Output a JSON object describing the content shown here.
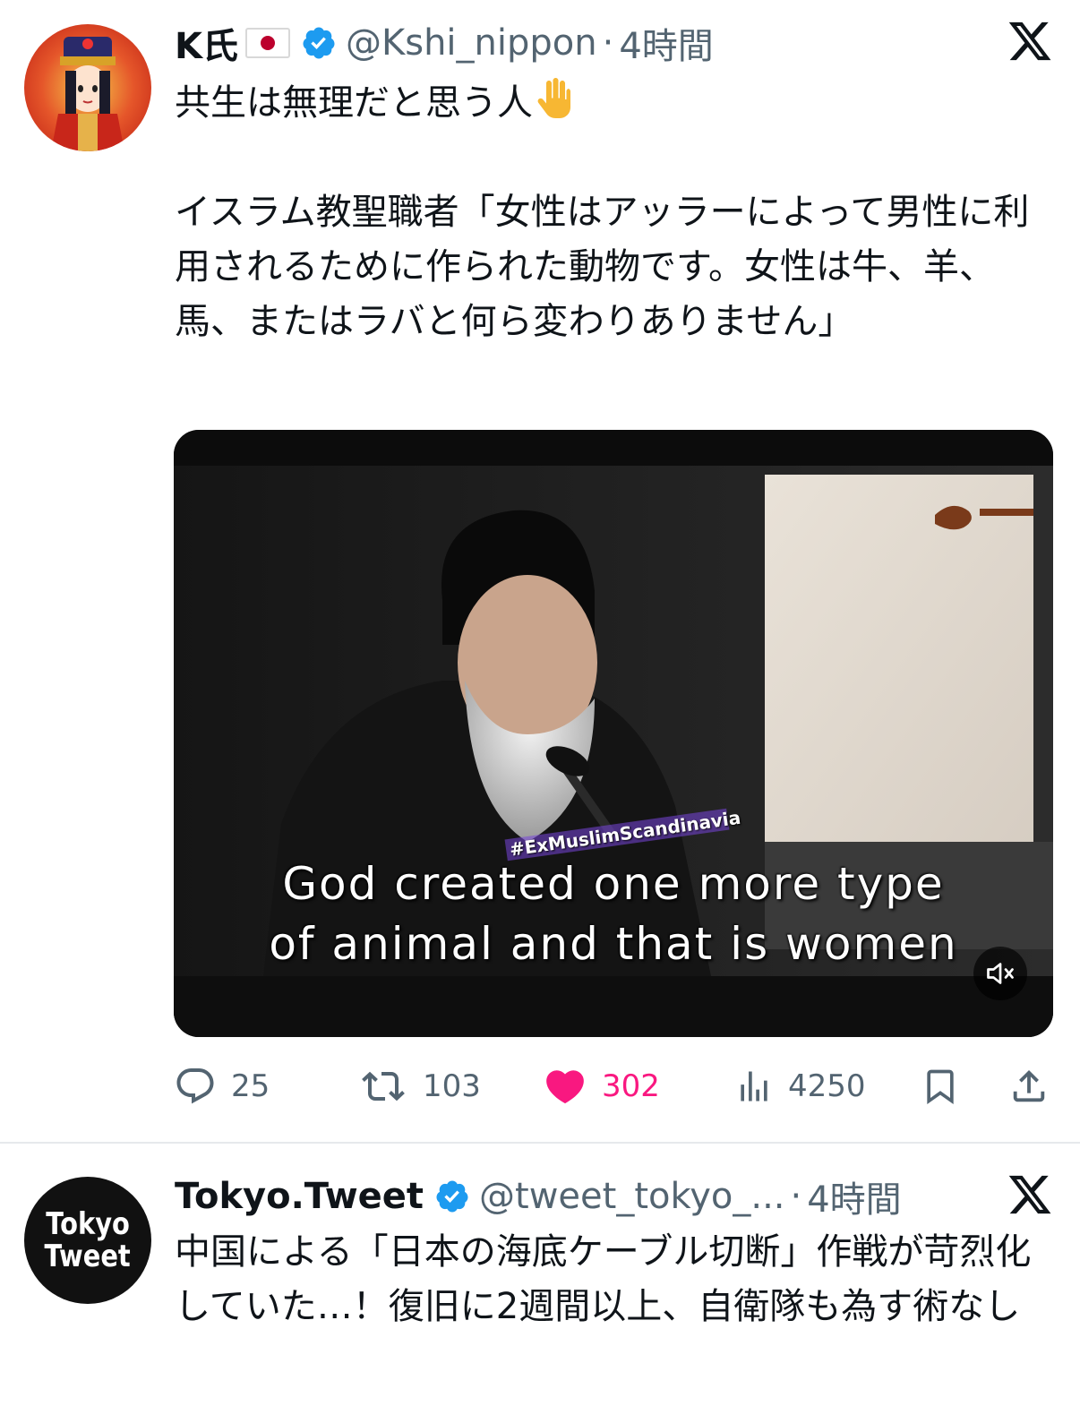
{
  "tweets": [
    {
      "author_name": "K氏",
      "flag_icon": "japan-flag-icon",
      "handle": "@Kshi_nippon",
      "separator": "·",
      "time": "4時間",
      "text": "共生は無理だと思う人",
      "text_emoji": "raised-hand-emoji",
      "text_body": "イスラム教聖職者「女性はアッラーによって男性に利用されるために作られた動物です。女性は牛、羊、馬、またはラバと何ら変わりありません」",
      "media": {
        "caption_line_1": "God created one more type",
        "caption_line_2": "of animal and that is women",
        "watermark": "#ExMuslimScandinavia",
        "mute_icon": "speaker-muted-icon"
      },
      "actions": {
        "replies": "25",
        "retweets": "103",
        "likes": "302",
        "views": "4250"
      },
      "colors": {
        "like": "#f91880",
        "verified": "#1d9bf0",
        "muted_text": "#536471"
      }
    },
    {
      "author_name": "Tokyo.Tweet",
      "avatar_line_1": "Tokyo",
      "avatar_line_2": "Tweet",
      "handle": "@tweet_tokyo_...",
      "separator": "·",
      "time": "4時間",
      "text": "中国による「日本の海底ケーブル切断」作戦が苛烈化していた…！復旧に2週間以上、自衛隊も為す術なし"
    }
  ]
}
